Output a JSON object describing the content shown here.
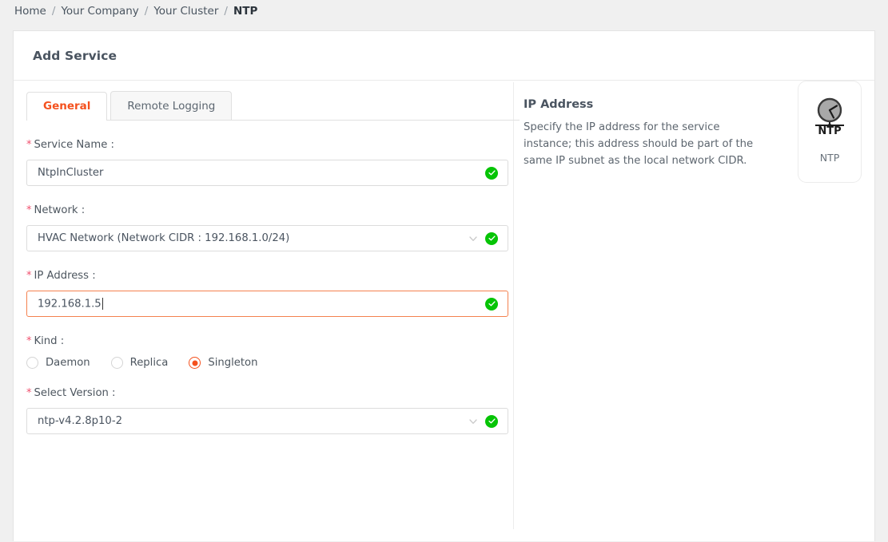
{
  "breadcrumb": {
    "items": [
      {
        "label": "Home",
        "current": false
      },
      {
        "label": "Your Company",
        "current": false
      },
      {
        "label": "Your Cluster",
        "current": false
      },
      {
        "label": "NTP",
        "current": true
      }
    ],
    "separator": "/"
  },
  "card": {
    "title": "Add Service"
  },
  "tabs": [
    {
      "label": "General",
      "active": true
    },
    {
      "label": "Remote Logging",
      "active": false
    }
  ],
  "form": {
    "required_marker": "*",
    "service_name": {
      "label": "Service Name :",
      "value": "NtpInCluster",
      "placeholder": "",
      "status_icon": "check-circle-icon"
    },
    "network": {
      "label": "Network :",
      "value": "HVAC Network (Network CIDR : 192.168.1.0/24)",
      "dropdown_icon": "chevron-down-icon",
      "status_icon": "check-circle-icon"
    },
    "ip_address": {
      "label": "IP Address :",
      "value": "192.168.1.5",
      "placeholder": "",
      "focused": true,
      "status_icon": "check-circle-icon"
    },
    "kind": {
      "label": "Kind :",
      "options": [
        {
          "label": "Daemon",
          "selected": false
        },
        {
          "label": "Replica",
          "selected": false
        },
        {
          "label": "Singleton",
          "selected": true
        }
      ]
    },
    "select_version": {
      "label": "Select Version :",
      "value": "ntp-v4.2.8p10-2",
      "dropdown_icon": "chevron-down-icon",
      "status_icon": "check-circle-icon"
    }
  },
  "help": {
    "title": "IP Address",
    "text": "Specify the IP address for the service instance; this address should be part of the same IP subnet as the local network CIDR."
  },
  "logo": {
    "icon": "ntp-clock-icon",
    "badge_text": "NTP",
    "label": "NTP"
  },
  "colors": {
    "accent": "#f4511e",
    "required": "#f0506e",
    "success": "#06c406",
    "page_background": "#f0f0f0",
    "card_background": "#ffffff",
    "text": "#4d565f"
  }
}
